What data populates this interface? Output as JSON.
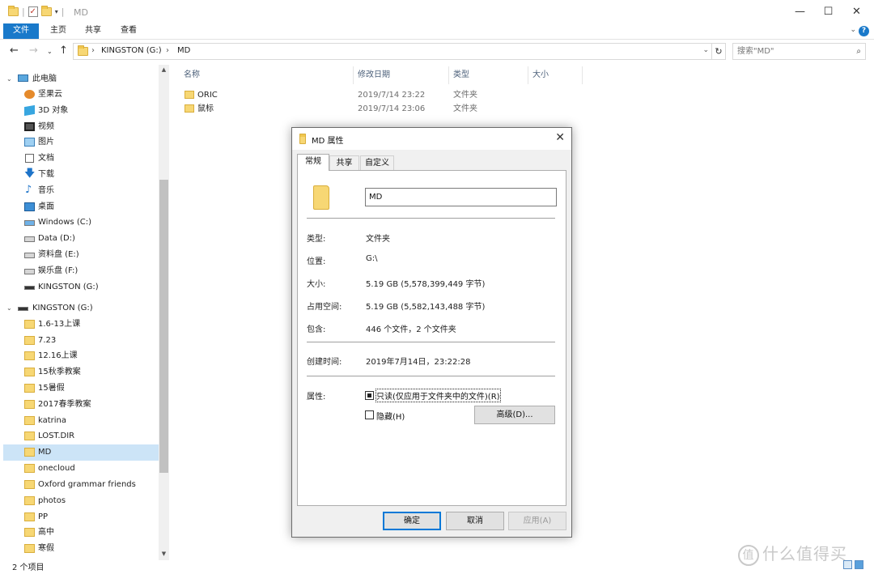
{
  "window": {
    "title": "MD",
    "controls": {
      "minimize": "—",
      "maximize": "☐",
      "close": "✕"
    }
  },
  "ribbon": {
    "tabs": [
      "文件",
      "主页",
      "共享",
      "查看"
    ],
    "collapse_icon": "chevron-down-icon",
    "help": "?"
  },
  "address": {
    "crumbs": [
      "KINGSTON (G:)",
      "MD"
    ],
    "separator": "›",
    "search_placeholder": "搜索\"MD\""
  },
  "nav": {
    "this_pc": "此电脑",
    "pc_items": [
      {
        "label": "坚果云",
        "icon": "nutstore-icon"
      },
      {
        "label": "3D 对象",
        "icon": "3d-objects-icon"
      },
      {
        "label": "视频",
        "icon": "video-icon"
      },
      {
        "label": "图片",
        "icon": "pictures-icon"
      },
      {
        "label": "文档",
        "icon": "documents-icon"
      },
      {
        "label": "下载",
        "icon": "download-icon"
      },
      {
        "label": "音乐",
        "icon": "music-icon"
      },
      {
        "label": "桌面",
        "icon": "desktop-icon"
      },
      {
        "label": "Windows (C:)",
        "icon": "drive-icon"
      },
      {
        "label": "Data (D:)",
        "icon": "drive-icon"
      },
      {
        "label": "资料盘 (E:)",
        "icon": "drive-icon"
      },
      {
        "label": "娱乐盘 (F:)",
        "icon": "drive-icon"
      },
      {
        "label": "KINGSTON (G:)",
        "icon": "usb-drive-icon"
      }
    ],
    "drive": "KINGSTON (G:)",
    "drive_folders": [
      "1.6-13上课",
      "7.23",
      "12.16上课",
      "15秋季教案",
      "15暑假",
      "2017春季教案",
      "katrina",
      "LOST.DIR",
      "MD",
      "onecloud",
      "Oxford grammar friends",
      "photos",
      "PP",
      "高中",
      "寒假"
    ],
    "selected": "MD"
  },
  "files": {
    "columns": [
      "名称",
      "修改日期",
      "类型",
      "大小"
    ],
    "rows": [
      {
        "name": "ORIC",
        "modified": "2019/7/14 23:22",
        "type": "文件夹"
      },
      {
        "name": "鼠标",
        "modified": "2019/7/14 23:06",
        "type": "文件夹"
      }
    ]
  },
  "status": {
    "count": "2 个项目"
  },
  "watermark": {
    "logo": "值",
    "text": "什么值得买"
  },
  "dialog": {
    "title": "MD 属性",
    "tabs": [
      "常规",
      "共享",
      "自定义"
    ],
    "name_value": "MD",
    "props": [
      {
        "label": "类型:",
        "value": "文件夹"
      },
      {
        "label": "位置:",
        "value": "G:\\"
      },
      {
        "label": "大小:",
        "value": "5.19 GB (5,578,399,449 字节)"
      },
      {
        "label": "占用空间:",
        "value": "5.19 GB (5,582,143,488 字节)"
      },
      {
        "label": "包含:",
        "value": "446 个文件，2 个文件夹"
      }
    ],
    "created_label": "创建时间:",
    "created_value": "2019年7月14日，23:22:28",
    "attr_label": "属性:",
    "readonly_label": "只读(仅应用于文件夹中的文件)(R)",
    "hidden_label": "隐藏(H)",
    "advanced_button": "高级(D)...",
    "ok": "确定",
    "cancel": "取消",
    "apply": "应用(A)"
  }
}
